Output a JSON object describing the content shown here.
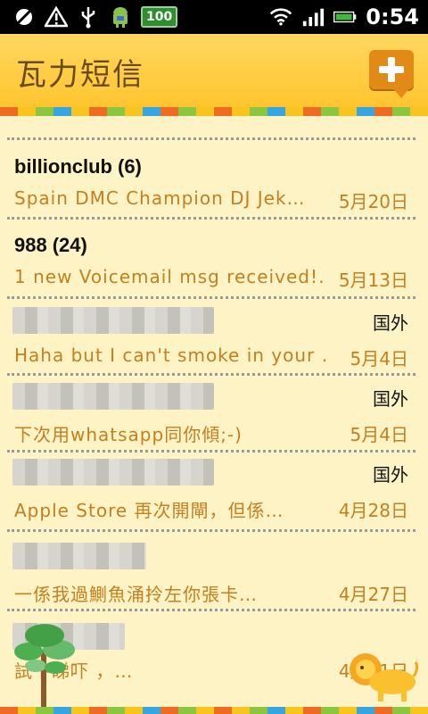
{
  "status_bar": {
    "battery_level": "100",
    "time": "0:54",
    "icons": [
      "missed-call-icon",
      "warning-icon",
      "usb-icon",
      "android-icon",
      "wifi-icon",
      "signal-icon",
      "battery-icon"
    ]
  },
  "app": {
    "title": "瓦力短信",
    "compose_icon": "compose-plus-icon"
  },
  "colors": {
    "header": "#ffc52f",
    "background": "#fdf3c4",
    "preview_text": "#c47f1f",
    "strip": [
      "#ef6b22",
      "#f7c51e",
      "#8cc63f",
      "#35a6e0",
      "#f7c51e",
      "#ef6b22",
      "#8cc63f",
      "#f7c51e",
      "#35a6e0",
      "#ef6b22",
      "#8cc63f",
      "#f7c51e"
    ]
  },
  "conversations": [
    {
      "sender": "billionclub",
      "count": "(6)",
      "preview": "Spain DMC Champion DJ Jek…",
      "date": "5月20日",
      "region": ""
    },
    {
      "sender": "988",
      "count": "(24)",
      "preview": "1 new Voicemail msg received!…",
      "date": "5月13日",
      "region": ""
    },
    {
      "sender": "",
      "count": "",
      "preview": "Haha but I can't smoke in your …",
      "date": "5月4日",
      "region": "国外"
    },
    {
      "sender": "",
      "count": "",
      "preview": "下次用whatsapp同你傾;-)",
      "date": "5月4日",
      "region": "国外"
    },
    {
      "sender": "",
      "count": "",
      "preview": "Apple Store 再次開閘，但係…",
      "date": "4月28日",
      "region": "国外"
    },
    {
      "sender": "",
      "count": "",
      "preview": "一係我過鰂魚涌拎左你張卡…",
      "date": "4月27日",
      "region": ""
    },
    {
      "sender": "",
      "count": "",
      "preview": "試下睇吓 ，…",
      "date": "4月21日",
      "region": ""
    }
  ]
}
